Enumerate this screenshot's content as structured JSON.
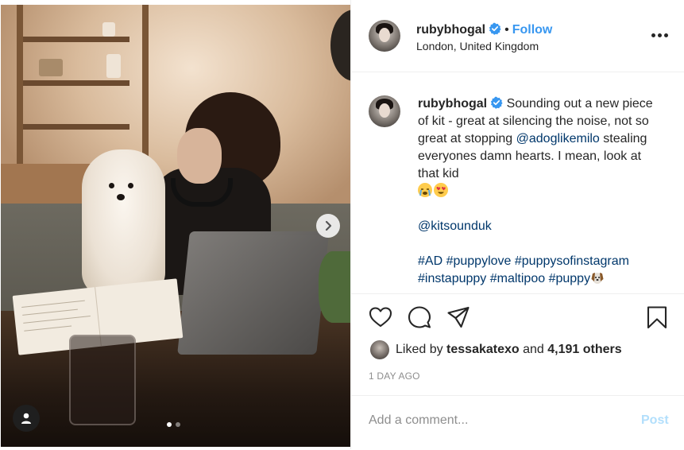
{
  "post": {
    "author": {
      "username": "rubybhogal",
      "location": "London, United Kingdom",
      "verified": true,
      "verified_icon": "verified-badge-icon"
    },
    "follow_label": "Follow",
    "bullet": "•",
    "caption": {
      "username": "rubybhogal",
      "text_1": "Sounding out a new piece of kit - great at silencing the noise, not so great at stopping ",
      "mention_1": "@adoglikemilo",
      "text_2": " stealing everyones damn hearts. I mean, look at that kid",
      "emojis_1": [
        "loudly-crying-face-emoji",
        "heart-eyes-emoji"
      ],
      "mention_2": "@kitsounduk",
      "hashtags_line1": [
        "#AD",
        "#puppylove",
        "#puppysofinstagram"
      ],
      "hashtags_line2": [
        "#instapuppy",
        "#maltipoo",
        "#puppy"
      ],
      "trailing_emoji": "dog-face-emoji"
    },
    "likes": {
      "prefix": "Liked by",
      "liker": "tessakatexo",
      "middle": "and",
      "others": "4,191 others"
    },
    "timestamp": "1 DAY AGO",
    "comment_placeholder": "Add a comment...",
    "post_label": "Post",
    "carousel": {
      "count": 2,
      "active_index": 0
    }
  },
  "colors": {
    "accent": "#3897f0",
    "verified": "#3897f0",
    "hashtag": "#00376b",
    "muted": "#8e8e8e",
    "post_disabled": "#b2dffc"
  },
  "icons": {
    "next": "chevron-right-icon",
    "tag": "user-tag-icon",
    "more": "more-options-icon",
    "like": "heart-icon",
    "comment": "comment-bubble-icon",
    "share": "paper-plane-icon",
    "save": "bookmark-icon"
  }
}
